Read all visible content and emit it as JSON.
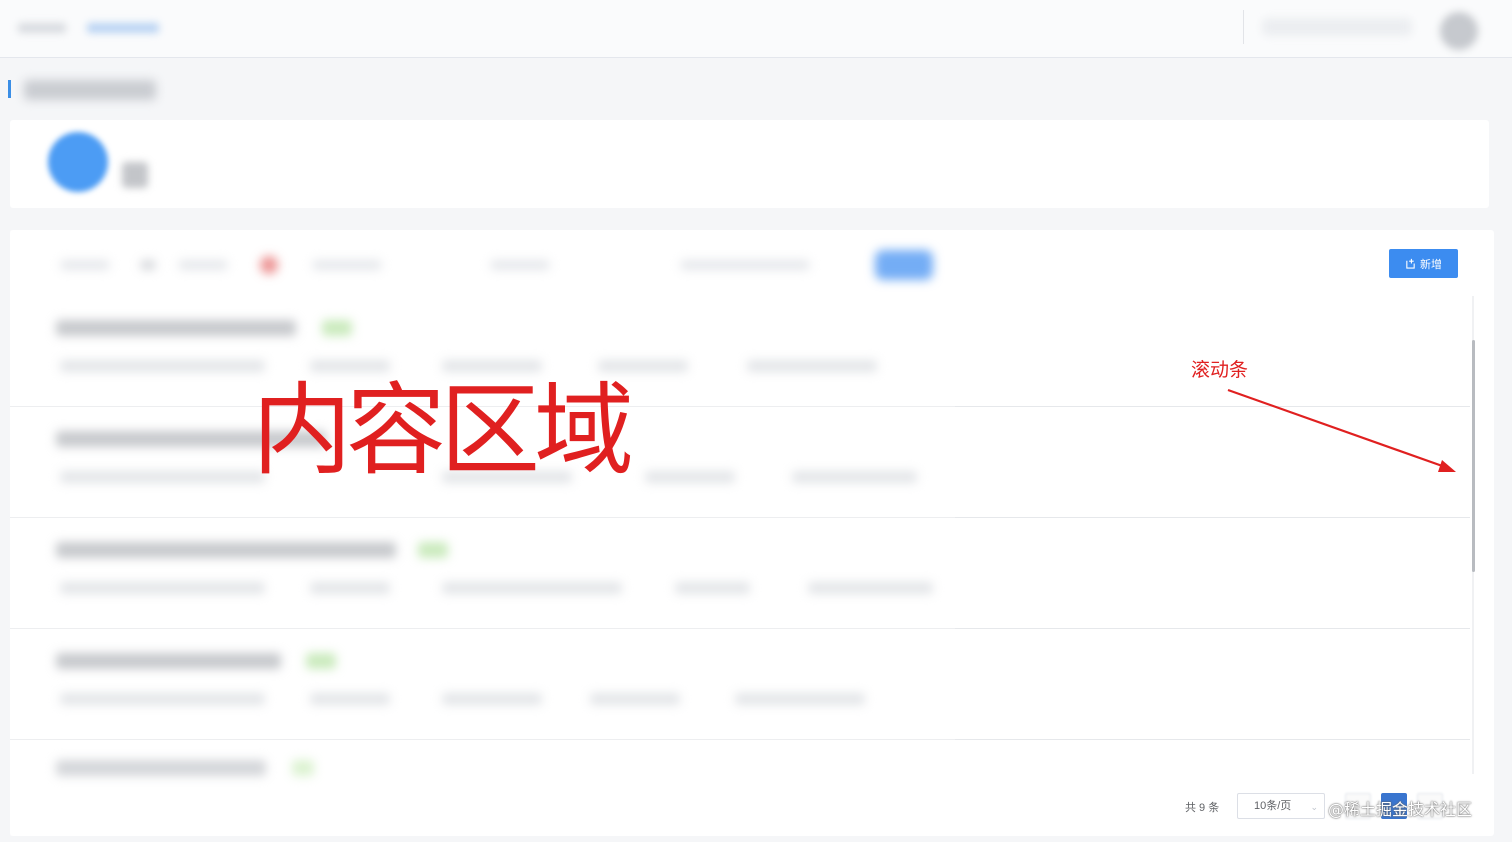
{
  "toolbar": {
    "add_label": "新增"
  },
  "icons": {
    "add": "add-document-icon",
    "scroll_caret": "chevron-down-icon"
  },
  "pagination": {
    "total": "共 9 条",
    "page_size": "10条/页",
    "current_page": 1
  },
  "annotations": {
    "content_area": "内容区域",
    "scrollbar": "滚动条"
  },
  "watermark": "@稀土掘金技术社区",
  "colors": {
    "primary": "#3c8cf0",
    "annotation": "#e02020",
    "background": "#f5f6f8"
  }
}
